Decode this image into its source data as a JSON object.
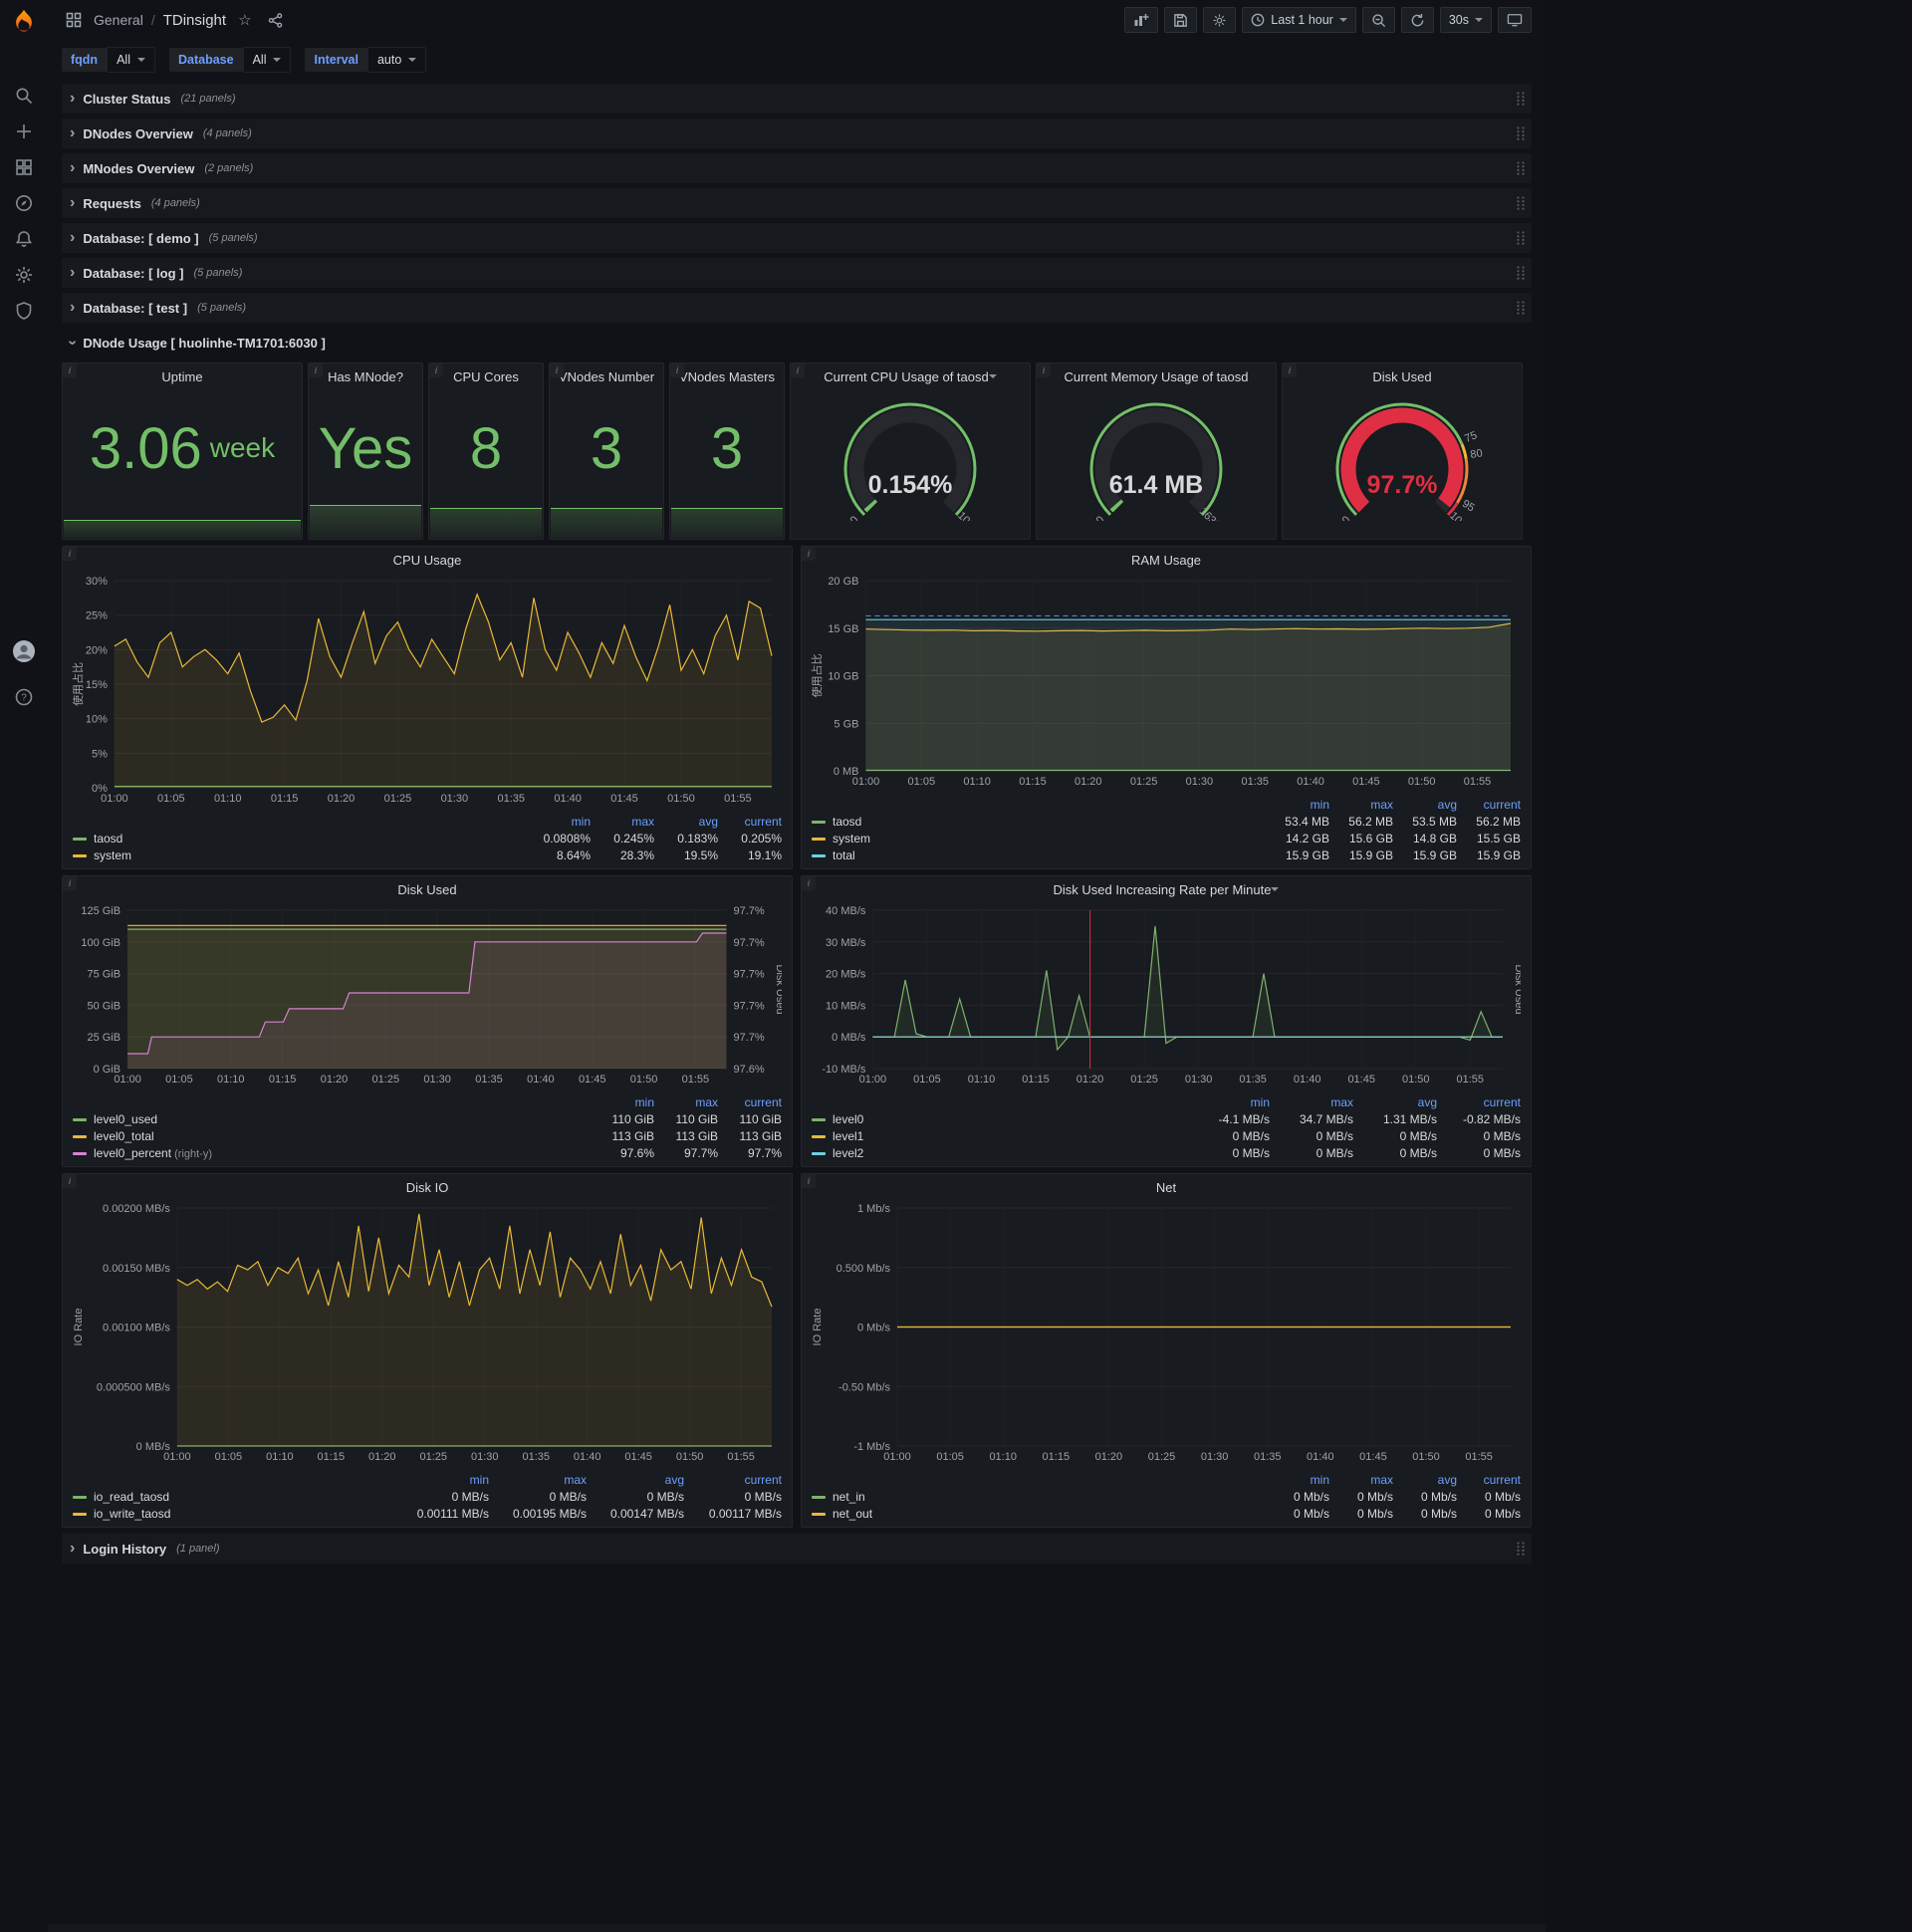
{
  "nav": {
    "section": "General",
    "separator": "/",
    "title": "TDinsight",
    "time_label": "Last 1 hour",
    "refresh_label": "30s"
  },
  "variables": [
    {
      "label": "fqdn",
      "value": "All"
    },
    {
      "label": "Database",
      "value": "All"
    },
    {
      "label": "Interval",
      "value": "auto"
    }
  ],
  "rows": [
    {
      "title": "Cluster Status",
      "count": "(21 panels)"
    },
    {
      "title": "DNodes Overview",
      "count": "(4 panels)"
    },
    {
      "title": "MNodes Overview",
      "count": "(2 panels)"
    },
    {
      "title": "Requests",
      "count": "(4 panels)"
    },
    {
      "title": "Database: [ demo ]",
      "count": "(5 panels)"
    },
    {
      "title": "Database: [ log ]",
      "count": "(5 panels)"
    },
    {
      "title": "Database: [ test ]",
      "count": "(5 panels)"
    }
  ],
  "dnode_row": {
    "title": "DNode Usage [ huolinhe-TM1701:6030 ]"
  },
  "login_row": {
    "title": "Login History",
    "count": "(1 panel)"
  },
  "stats": [
    {
      "title": "Uptime",
      "value": "3.06",
      "unit": "week"
    },
    {
      "title": "Has MNode?",
      "value": "Yes",
      "unit": ""
    },
    {
      "title": "CPU Cores",
      "value": "8",
      "unit": ""
    },
    {
      "title": "VNodes Number",
      "value": "3",
      "unit": ""
    },
    {
      "title": "VNodes Masters",
      "value": "3",
      "unit": ""
    }
  ],
  "gauges": [
    {
      "id": "cpu-gauge",
      "title": "Current CPU Usage of taosd",
      "menu": true,
      "value": "0.154%",
      "min": "0",
      "max": "100",
      "pct": 0.00154,
      "color": "#73bf69",
      "value_color": "#d8d9da",
      "thresholds": []
    },
    {
      "id": "mem-gauge",
      "title": "Current Memory Usage of taosd",
      "menu": false,
      "value": "61.4 MB",
      "min": "0",
      "max": "16384",
      "pct": 0.0037,
      "color": "#73bf69",
      "value_color": "#d8d9da",
      "thresholds": []
    },
    {
      "id": "disk-gauge",
      "title": "Disk Used",
      "menu": false,
      "value": "97.7%",
      "min": "0",
      "max": "100",
      "pct": 0.977,
      "color": "#e02f44",
      "value_color": "#e02f44",
      "thresholds": [
        {
          "pct": 0.75,
          "label": "75"
        },
        {
          "pct": 0.8,
          "label": "80"
        },
        {
          "pct": 0.95,
          "label": "95"
        }
      ]
    }
  ],
  "chart_data": [
    {
      "id": "cpu-usage",
      "type": "line",
      "title": "CPU Usage",
      "menu": false,
      "ylabel": "使用占比",
      "ylim": [
        0,
        30
      ],
      "y_ticks": [
        {
          "v": 0,
          "label": "0%"
        },
        {
          "v": 5,
          "label": "5%"
        },
        {
          "v": 10,
          "label": "10%"
        },
        {
          "v": 15,
          "label": "15%"
        },
        {
          "v": 20,
          "label": "20%"
        },
        {
          "v": 25,
          "label": "25%"
        },
        {
          "v": 30,
          "label": "30%"
        }
      ],
      "x_ticks": [
        "01:00",
        "01:05",
        "01:10",
        "01:15",
        "01:20",
        "01:25",
        "01:30",
        "01:35",
        "01:40",
        "01:45",
        "01:50",
        "01:55"
      ],
      "series": [
        {
          "name": "taosd",
          "color": "#7eb26d",
          "values": [
            0.2,
            0.2
          ]
        },
        {
          "name": "system",
          "color": "#eab839",
          "values": [
            20.5,
            21.5,
            18.2,
            16,
            21,
            22.5,
            17.5,
            19,
            20,
            18.5,
            16.5,
            19.5,
            14,
            9.5,
            10.2,
            12,
            9.8,
            15.5,
            24.5,
            19,
            16,
            21,
            25.5,
            18,
            22,
            24,
            20,
            17.5,
            21.5,
            19,
            16.5,
            23,
            28,
            24,
            18.5,
            21,
            16,
            27.5,
            20,
            17,
            22.5,
            19.5,
            16,
            21,
            18,
            23.5,
            19,
            15.5,
            20.5,
            26.5,
            17,
            20,
            16.5,
            22,
            25,
            18.5,
            27,
            26,
            19.1
          ]
        }
      ],
      "legend_cols": [
        "min",
        "max",
        "avg",
        "current"
      ],
      "legend": [
        {
          "name": "taosd",
          "color": "#7eb26d",
          "values": [
            "0.0808%",
            "0.245%",
            "0.183%",
            "0.205%"
          ]
        },
        {
          "name": "system",
          "color": "#eab839",
          "values": [
            "8.64%",
            "28.3%",
            "19.5%",
            "19.1%"
          ]
        }
      ]
    },
    {
      "id": "ram-usage",
      "type": "line",
      "title": "RAM Usage",
      "menu": false,
      "ylabel": "使用占比",
      "ylim": [
        0,
        20
      ],
      "y_ticks": [
        {
          "v": 0,
          "label": "0 MB"
        },
        {
          "v": 5,
          "label": "5 GB"
        },
        {
          "v": 10,
          "label": "10 GB"
        },
        {
          "v": 15,
          "label": "15 GB"
        },
        {
          "v": 20,
          "label": "20 GB"
        }
      ],
      "x_ticks": [
        "01:00",
        "01:05",
        "01:10",
        "01:15",
        "01:20",
        "01:25",
        "01:30",
        "01:35",
        "01:40",
        "01:45",
        "01:50",
        "01:55"
      ],
      "annotations": [
        {
          "type": "hline",
          "y": 16.3,
          "color": "#5794f2"
        }
      ],
      "series": [
        {
          "name": "taosd",
          "color": "#7eb26d",
          "values": [
            0.055,
            0.055
          ]
        },
        {
          "name": "system",
          "color": "#eab839",
          "values": [
            14.9,
            14.85,
            14.8,
            14.78,
            14.8,
            14.72,
            14.75,
            14.7,
            14.68,
            14.72,
            14.75,
            14.7,
            14.73,
            14.78,
            14.72,
            14.75,
            14.8,
            14.9,
            14.85,
            14.9,
            14.95,
            14.9,
            14.92,
            14.88,
            14.9,
            14.95,
            15.0,
            14.95,
            15.0,
            15.1,
            15.5
          ]
        },
        {
          "name": "total",
          "color": "#6ed0e0",
          "values": [
            15.9,
            15.9
          ]
        }
      ],
      "legend_cols": [
        "min",
        "max",
        "avg",
        "current"
      ],
      "legend": [
        {
          "name": "taosd",
          "color": "#7eb26d",
          "values": [
            "53.4 MB",
            "56.2 MB",
            "53.5 MB",
            "56.2 MB"
          ]
        },
        {
          "name": "system",
          "color": "#eab839",
          "values": [
            "14.2 GB",
            "15.6 GB",
            "14.8 GB",
            "15.5 GB"
          ]
        },
        {
          "name": "total",
          "color": "#6ed0e0",
          "values": [
            "15.9 GB",
            "15.9 GB",
            "15.9 GB",
            "15.9 GB"
          ]
        }
      ]
    },
    {
      "id": "disk-used",
      "type": "line",
      "title": "Disk Used",
      "menu": false,
      "ylabel": "",
      "ylabel_right": "Disk Used",
      "ylim": [
        0,
        125
      ],
      "y_ticks": [
        {
          "v": 0,
          "label": "0 GiB"
        },
        {
          "v": 25,
          "label": "25 GiB"
        },
        {
          "v": 50,
          "label": "50 GiB"
        },
        {
          "v": 75,
          "label": "75 GiB"
        },
        {
          "v": 100,
          "label": "100 GiB"
        },
        {
          "v": 125,
          "label": "125 GiB"
        }
      ],
      "y_ticks_right": [
        "97.6%",
        "97.7%",
        "97.7%",
        "97.7%",
        "97.7%",
        "97.7%"
      ],
      "x_ticks": [
        "01:00",
        "01:05",
        "01:10",
        "01:15",
        "01:20",
        "01:25",
        "01:30",
        "01:35",
        "01:40",
        "01:45",
        "01:50",
        "01:55"
      ],
      "series": [
        {
          "name": "level0_used",
          "color": "#7eb26d",
          "values": [
            110,
            110
          ]
        },
        {
          "name": "level0_total",
          "color": "#eab839",
          "values": [
            113,
            113
          ]
        },
        {
          "name": "level0_percent",
          "color": "#d683ce",
          "ylim": [
            97.56,
            97.74
          ],
          "x": [
            0,
            0.034,
            0.04,
            0.22,
            0.23,
            0.26,
            0.27,
            0.36,
            0.37,
            0.57,
            0.58,
            0.95,
            0.96,
            1.0
          ],
          "values": [
            97.577,
            97.577,
            97.596,
            97.596,
            97.613,
            97.613,
            97.628,
            97.628,
            97.646,
            97.646,
            97.704,
            97.704,
            97.714,
            97.714
          ]
        }
      ],
      "legend_cols": [
        "min",
        "max",
        "current"
      ],
      "legend": [
        {
          "name": "level0_used",
          "color": "#7eb26d",
          "values": [
            "110 GiB",
            "110 GiB",
            "110 GiB"
          ]
        },
        {
          "name": "level0_total",
          "color": "#eab839",
          "values": [
            "113 GiB",
            "113 GiB",
            "113 GiB"
          ]
        },
        {
          "name": "level0_percent",
          "suffix": "(right-y)",
          "color": "#d683ce",
          "values": [
            "97.6%",
            "97.7%",
            "97.7%"
          ]
        }
      ]
    },
    {
      "id": "disk-rate",
      "type": "line",
      "title": "Disk Used Increasing Rate per Minute",
      "menu": true,
      "ylabel": "",
      "ylabel_right": "Disk Used",
      "ylim": [
        -10,
        40
      ],
      "y_ticks": [
        {
          "v": -10,
          "label": "-10 MB/s"
        },
        {
          "v": 0,
          "label": "0 MB/s"
        },
        {
          "v": 10,
          "label": "10 MB/s"
        },
        {
          "v": 20,
          "label": "20 MB/s"
        },
        {
          "v": 30,
          "label": "30 MB/s"
        },
        {
          "v": 40,
          "label": "40 MB/s"
        }
      ],
      "x_ticks": [
        "01:00",
        "01:05",
        "01:10",
        "01:15",
        "01:20",
        "01:25",
        "01:30",
        "01:35",
        "01:40",
        "01:45",
        "01:50",
        "01:55"
      ],
      "annotations": [
        {
          "type": "vline",
          "x": 0.345,
          "color": "#e02f44"
        }
      ],
      "series": [
        {
          "name": "level0",
          "color": "#7eb26d",
          "values": [
            0,
            0,
            0,
            18,
            1,
            0,
            0,
            0,
            12,
            0,
            0,
            0,
            0,
            0,
            0,
            0,
            21,
            -4,
            0,
            13,
            0,
            0,
            0,
            0,
            0,
            0,
            35,
            -2,
            0,
            0,
            0,
            0,
            0,
            0,
            0,
            0,
            20,
            0,
            0,
            0,
            0,
            0,
            0,
            0,
            0,
            0,
            0,
            0,
            0,
            0,
            0,
            0,
            0,
            0,
            0,
            -1,
            8,
            0,
            0
          ]
        },
        {
          "name": "level1",
          "color": "#eab839",
          "values": [
            0,
            0
          ]
        },
        {
          "name": "level2",
          "color": "#6ed0e0",
          "values": [
            0,
            0
          ]
        }
      ],
      "legend_cols": [
        "min",
        "max",
        "avg",
        "current"
      ],
      "legend": [
        {
          "name": "level0",
          "color": "#7eb26d",
          "values": [
            "-4.1 MB/s",
            "34.7 MB/s",
            "1.31 MB/s",
            "-0.82 MB/s"
          ]
        },
        {
          "name": "level1",
          "color": "#eab839",
          "values": [
            "0 MB/s",
            "0 MB/s",
            "0 MB/s",
            "0 MB/s"
          ]
        },
        {
          "name": "level2",
          "color": "#6ed0e0",
          "values": [
            "0 MB/s",
            "0 MB/s",
            "0 MB/s",
            "0 MB/s"
          ]
        }
      ]
    },
    {
      "id": "disk-io",
      "type": "line",
      "title": "Disk IO",
      "menu": false,
      "ylabel": "IO Rate",
      "ylim": [
        0,
        0.002
      ],
      "y_ticks": [
        {
          "v": 0,
          "label": "0 MB/s"
        },
        {
          "v": 0.0005,
          "label": "0.000500 MB/s"
        },
        {
          "v": 0.001,
          "label": "0.00100 MB/s"
        },
        {
          "v": 0.0015,
          "label": "0.00150 MB/s"
        },
        {
          "v": 0.002,
          "label": "0.00200 MB/s"
        }
      ],
      "x_ticks": [
        "01:00",
        "01:05",
        "01:10",
        "01:15",
        "01:20",
        "01:25",
        "01:30",
        "01:35",
        "01:40",
        "01:45",
        "01:50",
        "01:55"
      ],
      "series": [
        {
          "name": "io_read_taosd",
          "color": "#7eb26d",
          "values": [
            0,
            0
          ]
        },
        {
          "name": "io_write_taosd",
          "color": "#eab839",
          "values": [
            0.0014,
            0.00135,
            0.0014,
            0.00132,
            0.00138,
            0.0013,
            0.00152,
            0.00148,
            0.00155,
            0.00135,
            0.0015,
            0.00145,
            0.00158,
            0.00128,
            0.00148,
            0.00118,
            0.00155,
            0.00125,
            0.00185,
            0.0013,
            0.00175,
            0.00128,
            0.00152,
            0.00142,
            0.00195,
            0.00135,
            0.00165,
            0.00125,
            0.00155,
            0.00118,
            0.00148,
            0.00158,
            0.00132,
            0.00185,
            0.00128,
            0.00165,
            0.00135,
            0.0018,
            0.00125,
            0.00158,
            0.00148,
            0.00132,
            0.00155,
            0.00128,
            0.00178,
            0.00135,
            0.00152,
            0.00122,
            0.00165,
            0.00148,
            0.00155,
            0.00132,
            0.00192,
            0.00128,
            0.00158,
            0.00135,
            0.00165,
            0.00142,
            0.00138,
            0.00117
          ]
        }
      ],
      "legend_cols": [
        "min",
        "max",
        "avg",
        "current"
      ],
      "legend": [
        {
          "name": "io_read_taosd",
          "color": "#7eb26d",
          "values": [
            "0 MB/s",
            "0 MB/s",
            "0 MB/s",
            "0 MB/s"
          ]
        },
        {
          "name": "io_write_taosd",
          "color": "#eab839",
          "values": [
            "0.00111 MB/s",
            "0.00195 MB/s",
            "0.00147 MB/s",
            "0.00117 MB/s"
          ]
        }
      ]
    },
    {
      "id": "net",
      "type": "line",
      "title": "Net",
      "menu": false,
      "ylabel": "IO Rate",
      "ylim": [
        -1,
        1
      ],
      "y_ticks": [
        {
          "v": -1,
          "label": "-1 Mb/s"
        },
        {
          "v": -0.5,
          "label": "-0.50 Mb/s"
        },
        {
          "v": 0,
          "label": "0 Mb/s"
        },
        {
          "v": 0.5,
          "label": "0.500 Mb/s"
        },
        {
          "v": 1,
          "label": "1 Mb/s"
        }
      ],
      "x_ticks": [
        "01:00",
        "01:05",
        "01:10",
        "01:15",
        "01:20",
        "01:25",
        "01:30",
        "01:35",
        "01:40",
        "01:45",
        "01:50",
        "01:55"
      ],
      "series": [
        {
          "name": "net_in",
          "color": "#7eb26d",
          "values": [
            0,
            0
          ]
        },
        {
          "name": "net_out",
          "color": "#eab839",
          "values": [
            0,
            0
          ]
        }
      ],
      "legend_cols": [
        "min",
        "max",
        "avg",
        "current"
      ],
      "legend": [
        {
          "name": "net_in",
          "color": "#7eb26d",
          "values": [
            "0 Mb/s",
            "0 Mb/s",
            "0 Mb/s",
            "0 Mb/s"
          ]
        },
        {
          "name": "net_out",
          "color": "#eab839",
          "values": [
            "0 Mb/s",
            "0 Mb/s",
            "0 Mb/s",
            "0 Mb/s"
          ]
        }
      ]
    }
  ]
}
